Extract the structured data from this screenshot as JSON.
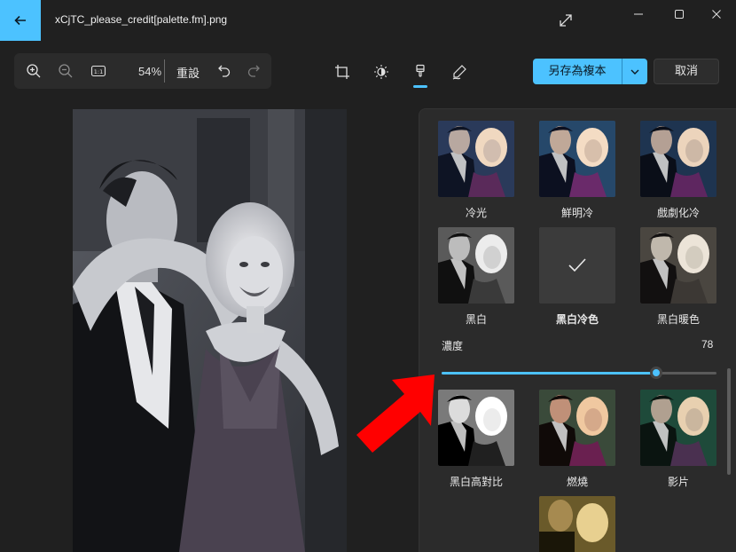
{
  "window": {
    "title": "xCjTC_please_credit[palette.fm].png"
  },
  "toolbar": {
    "zoom_level": "54%",
    "actual_size_label": "1:1",
    "reset_label": "重設"
  },
  "actions": {
    "save_copy_label": "另存為複本",
    "cancel_label": "取消"
  },
  "filters": [
    {
      "label": "冷光",
      "style": "cool"
    },
    {
      "label": "鮮明冷",
      "style": "vivid-cool"
    },
    {
      "label": "戲劇化冷",
      "style": "dramatic-cool"
    },
    {
      "label": "黑白",
      "style": "bw"
    },
    {
      "label": "黑白冷色",
      "style": "selected"
    },
    {
      "label": "黑白暖色",
      "style": "bw-warm"
    },
    {
      "label": "黑白高對比",
      "style": "bw-contrast"
    },
    {
      "label": "燃燒",
      "style": "burn"
    },
    {
      "label": "影片",
      "style": "film"
    }
  ],
  "intensity": {
    "label": "濃度",
    "value": "78",
    "fraction": 0.78
  },
  "colors": {
    "accent": "#4cc2ff",
    "background": "#202020",
    "panel": "#2b2b2b",
    "arrow": "#ff0000"
  }
}
